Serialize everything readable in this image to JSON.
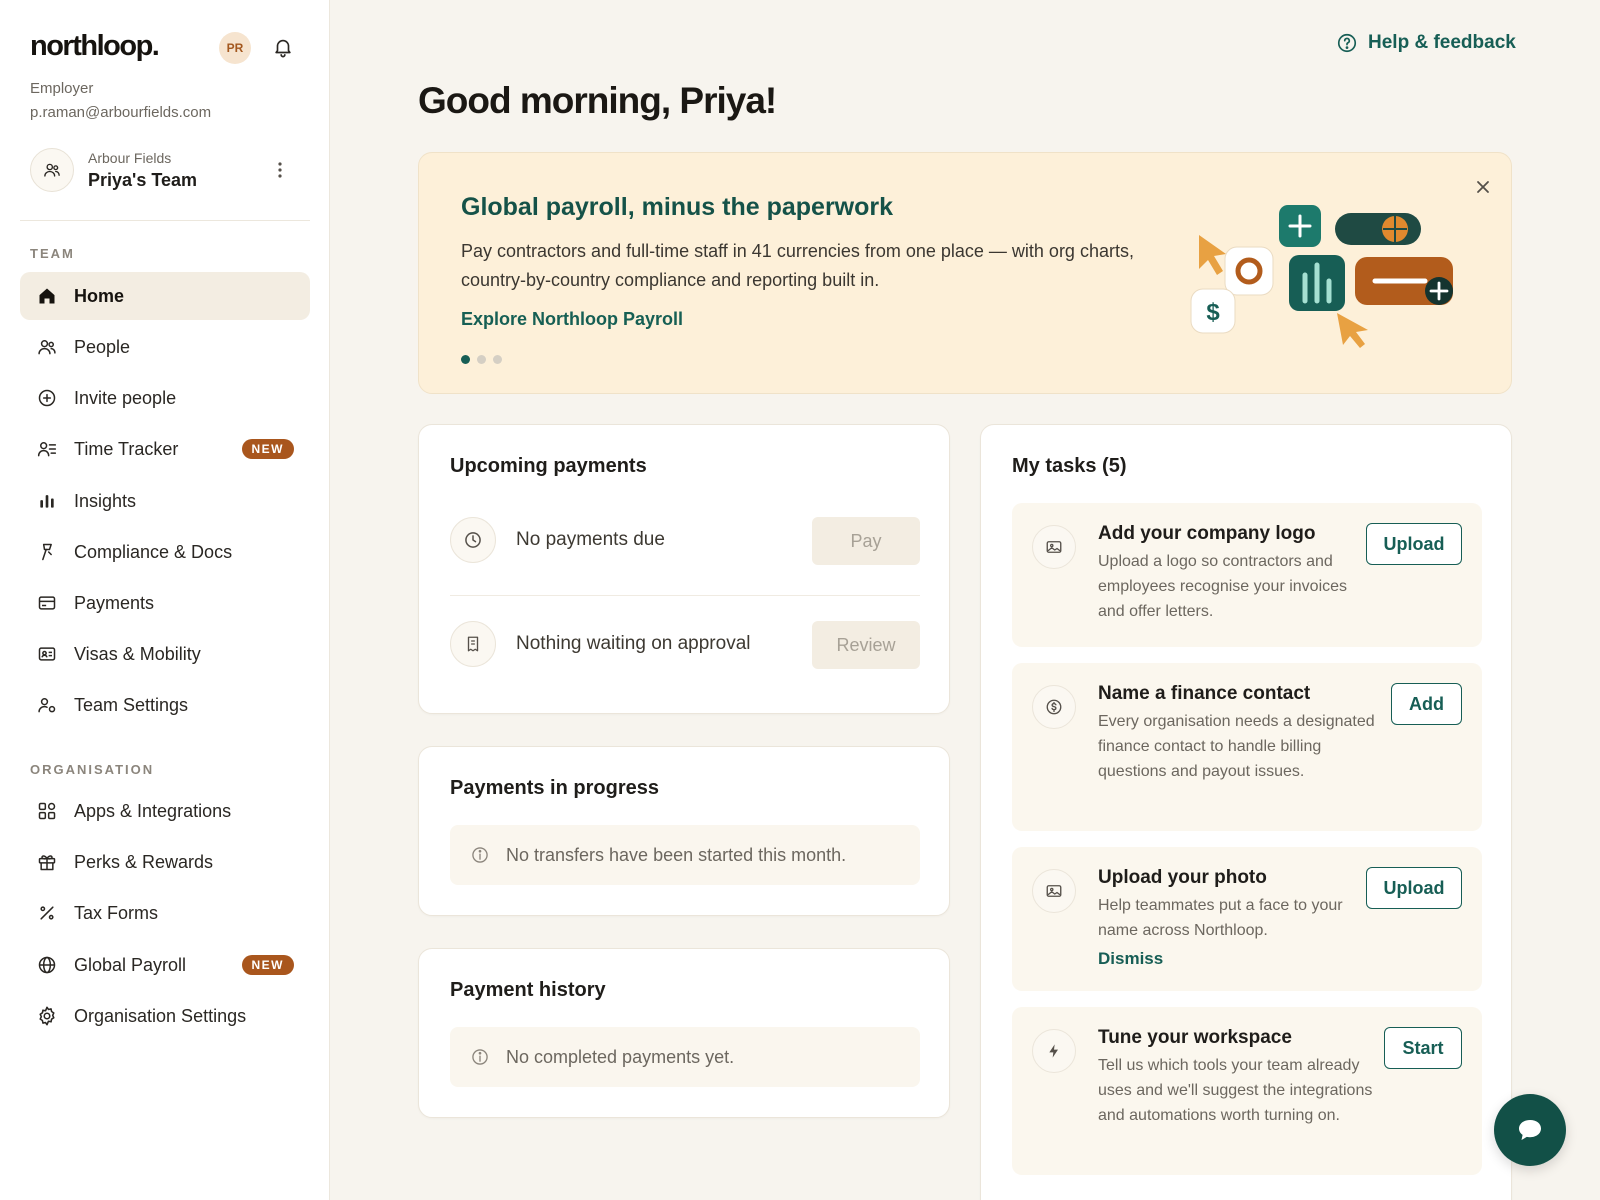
{
  "brand": {
    "logo": "northloop."
  },
  "user": {
    "initials": "PR",
    "role": "Employer",
    "email": "p.raman@arbourfields.com"
  },
  "team_selector": {
    "org": "Arbour Fields",
    "team": "Priya's Team"
  },
  "sidebar": {
    "team_label": "TEAM",
    "org_label": "ORGANISATION",
    "team_items": [
      {
        "label": "Home",
        "icon": "home-icon",
        "active": true
      },
      {
        "label": "People",
        "icon": "people-icon"
      },
      {
        "label": "Invite people",
        "icon": "plus-circle-icon"
      },
      {
        "label": "Time Tracker",
        "icon": "time-tracker-icon",
        "badge": "NEW"
      },
      {
        "label": "Insights",
        "icon": "bar-chart-icon"
      },
      {
        "label": "Compliance & Docs",
        "icon": "gavel-icon"
      },
      {
        "label": "Payments",
        "icon": "card-icon"
      },
      {
        "label": "Visas & Mobility",
        "icon": "id-card-icon"
      },
      {
        "label": "Team Settings",
        "icon": "user-gear-icon"
      }
    ],
    "org_items": [
      {
        "label": "Apps & Integrations",
        "icon": "grid-icon"
      },
      {
        "label": "Perks & Rewards",
        "icon": "gift-icon"
      },
      {
        "label": "Tax Forms",
        "icon": "percent-icon"
      },
      {
        "label": "Global Payroll",
        "icon": "globe-icon",
        "badge": "NEW"
      },
      {
        "label": "Organisation Settings",
        "icon": "gear-icon"
      }
    ]
  },
  "header": {
    "help": "Help & feedback",
    "greeting": "Good morning, Priya!"
  },
  "banner": {
    "title": "Global payroll, minus the paperwork",
    "body": "Pay contractors and full-time staff in 41 currencies from one place — with org charts, country-by-country compliance and reporting built in.",
    "link": "Explore Northloop Payroll",
    "slides": 3,
    "current_slide": 1
  },
  "upcoming": {
    "title": "Upcoming payments",
    "rows": [
      {
        "label": "No payments due",
        "button": "Pay",
        "icon": "clock-icon"
      },
      {
        "label": "Nothing waiting on approval",
        "button": "Review",
        "icon": "receipt-icon"
      }
    ]
  },
  "in_progress": {
    "title": "Payments in progress",
    "message": "No transfers have been started this month."
  },
  "history": {
    "title": "Payment history",
    "message": "No completed payments yet."
  },
  "tasks": {
    "title": "My tasks (5)",
    "items": [
      {
        "title": "Add your company logo",
        "desc": "Upload a logo so contractors and employees recognise your invoices and offer letters.",
        "button": "Upload",
        "icon": "image-icon"
      },
      {
        "title": "Name a finance contact",
        "desc": "Every organisation needs a designated finance contact to handle billing questions and payout issues.",
        "button": "Add",
        "icon": "dollar-circle-icon"
      },
      {
        "title": "Upload your photo",
        "desc": "Help teammates put a face to your name across Northloop.",
        "button": "Upload",
        "dismiss": "Dismiss",
        "icon": "image-icon"
      },
      {
        "title": "Tune your workspace",
        "desc": "Tell us which tools your team already uses and we'll suggest the integrations and automations worth turning on.",
        "button": "Start",
        "icon": "lightning-icon"
      }
    ]
  },
  "colors": {
    "accent": "#175e55",
    "badge": "#a9561d",
    "banner_bg": "#fdf0d9",
    "page_bg": "#f7f4ee"
  }
}
